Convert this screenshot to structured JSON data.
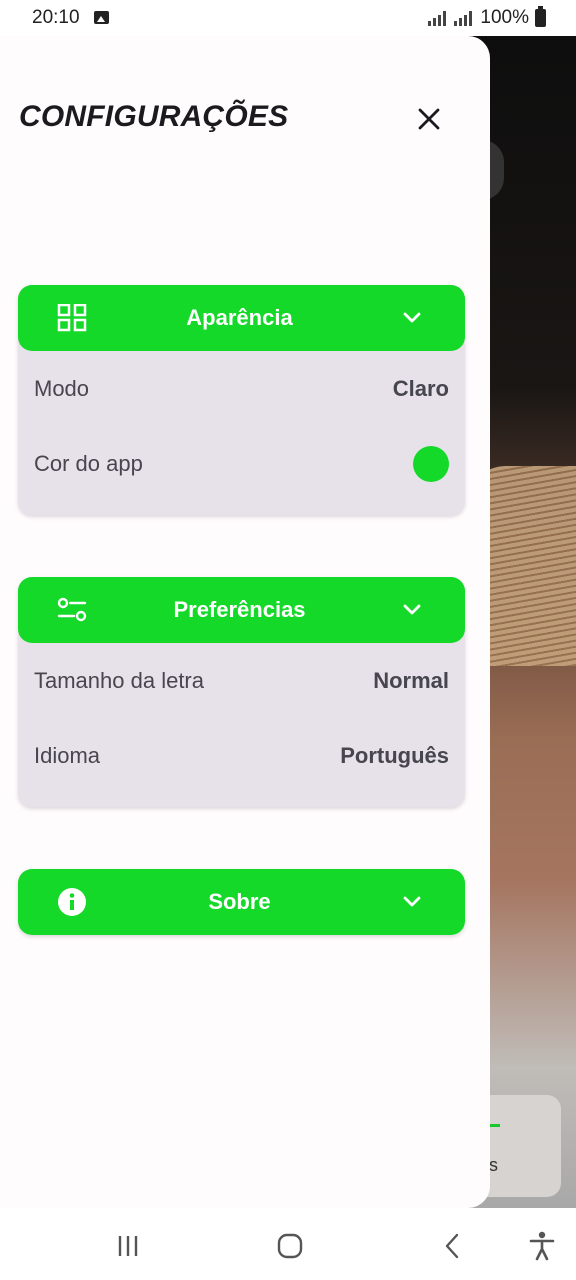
{
  "status_bar": {
    "time": "20:10",
    "battery": "100%"
  },
  "drawer": {
    "title": "CONFIGURAÇÕES",
    "close_icon": "close-icon",
    "sections": [
      {
        "title": "Aparência",
        "icon": "grid-icon",
        "rows": [
          {
            "label": "Modo",
            "value": "Claro"
          },
          {
            "label": "Cor do app",
            "value_color": "#14d929"
          }
        ]
      },
      {
        "title": "Preferências",
        "icon": "sliders-icon",
        "rows": [
          {
            "label": "Tamanho da letra",
            "value": "Normal"
          },
          {
            "label": "Idioma",
            "value": "Português"
          }
        ]
      },
      {
        "title": "Sobre",
        "icon": "info-icon",
        "rows": []
      }
    ]
  },
  "background": {
    "card_text": "ais"
  },
  "colors": {
    "accent": "#14d929",
    "section_bg": "#e7e1ea",
    "drawer_bg": "#fffcfe"
  },
  "nav_bar": {
    "buttons": [
      "recent-apps-icon",
      "home-icon",
      "back-icon",
      "accessibility-icon"
    ]
  }
}
